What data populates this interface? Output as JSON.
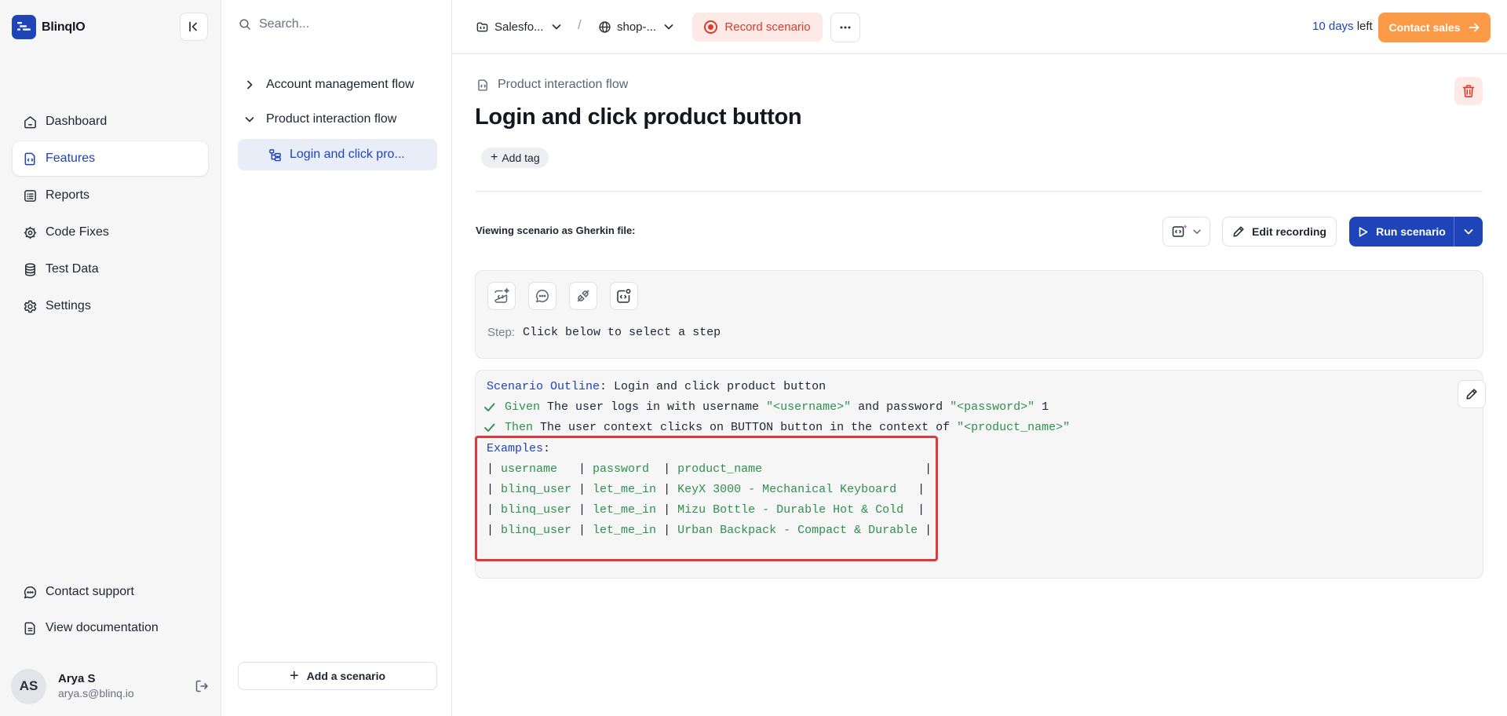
{
  "brand": {
    "name": "BlinqIO"
  },
  "sidebar": {
    "items": [
      {
        "label": "Dashboard",
        "icon": "home-icon",
        "active": false
      },
      {
        "label": "Features",
        "icon": "features-icon",
        "active": true
      },
      {
        "label": "Reports",
        "icon": "reports-icon",
        "active": false
      },
      {
        "label": "Code Fixes",
        "icon": "code-fixes-icon",
        "active": false
      },
      {
        "label": "Test Data",
        "icon": "database-icon",
        "active": false
      },
      {
        "label": "Settings",
        "icon": "gear-icon",
        "active": false
      }
    ],
    "bottom_items": [
      {
        "label": "Contact support",
        "icon": "chat-icon"
      },
      {
        "label": "View documentation",
        "icon": "document-icon"
      }
    ],
    "user": {
      "initials": "AS",
      "name": "Arya S",
      "email": "arya.s@blinq.io"
    }
  },
  "tree": {
    "search_placeholder": "Search...",
    "flows": [
      {
        "label": "Account management flow",
        "expanded": false
      },
      {
        "label": "Product interaction flow",
        "expanded": true
      }
    ],
    "selected_scenario": "Login and click pro...",
    "add_scenario_label": "Add a scenario"
  },
  "topbar": {
    "project": "Salesfo...",
    "environment": "shop-...",
    "separator": "/",
    "record_label": "Record scenario",
    "trial_days": "10 days",
    "trial_suffix": " left",
    "contact_sales_label": "Contact sales"
  },
  "main": {
    "flow_name": "Product interaction flow",
    "title": "Login and click product button",
    "add_tag_label": "Add tag",
    "viewing_label": "Viewing scenario as Gherkin file:",
    "edit_recording_label": "Edit recording",
    "run_label": "Run scenario",
    "step_label": "Step:",
    "step_value": "Click below to select a step"
  },
  "gherkin": {
    "outline_keyword": "Scenario Outline",
    "outline_colon": ": ",
    "outline_title": "Login and click product button",
    "given_keyword": "Given",
    "given_text": " The user logs in with username ",
    "given_arg1": "\"<username>\"",
    "given_mid": " and password ",
    "given_arg2": "\"<password>\"",
    "given_tail": " 1",
    "then_keyword": "Then",
    "then_text": " The user context clicks on BUTTON button in the context of ",
    "then_arg": "\"<product_name>\"",
    "examples_keyword": "Examples",
    "examples_colon": ":",
    "table": {
      "headers": [
        "username  ",
        "password ",
        "product_name                  "
      ],
      "rows": [
        [
          "blinq_user",
          "let_me_in",
          "KeyX 3000 - Mechanical Keyboard  "
        ],
        [
          "blinq_user",
          "let_me_in",
          "Mizu Bottle - Durable Hot & Cold  "
        ],
        [
          "blinq_user",
          "let_me_in",
          "Urban Backpack - Compact & Durable"
        ]
      ]
    }
  },
  "colors": {
    "accent": "#1e44b8",
    "record": "#dc3a2c",
    "contact_sales": "#fb9b48",
    "gherkin_string": "#2f8f4e",
    "highlight": "#e0383b"
  }
}
